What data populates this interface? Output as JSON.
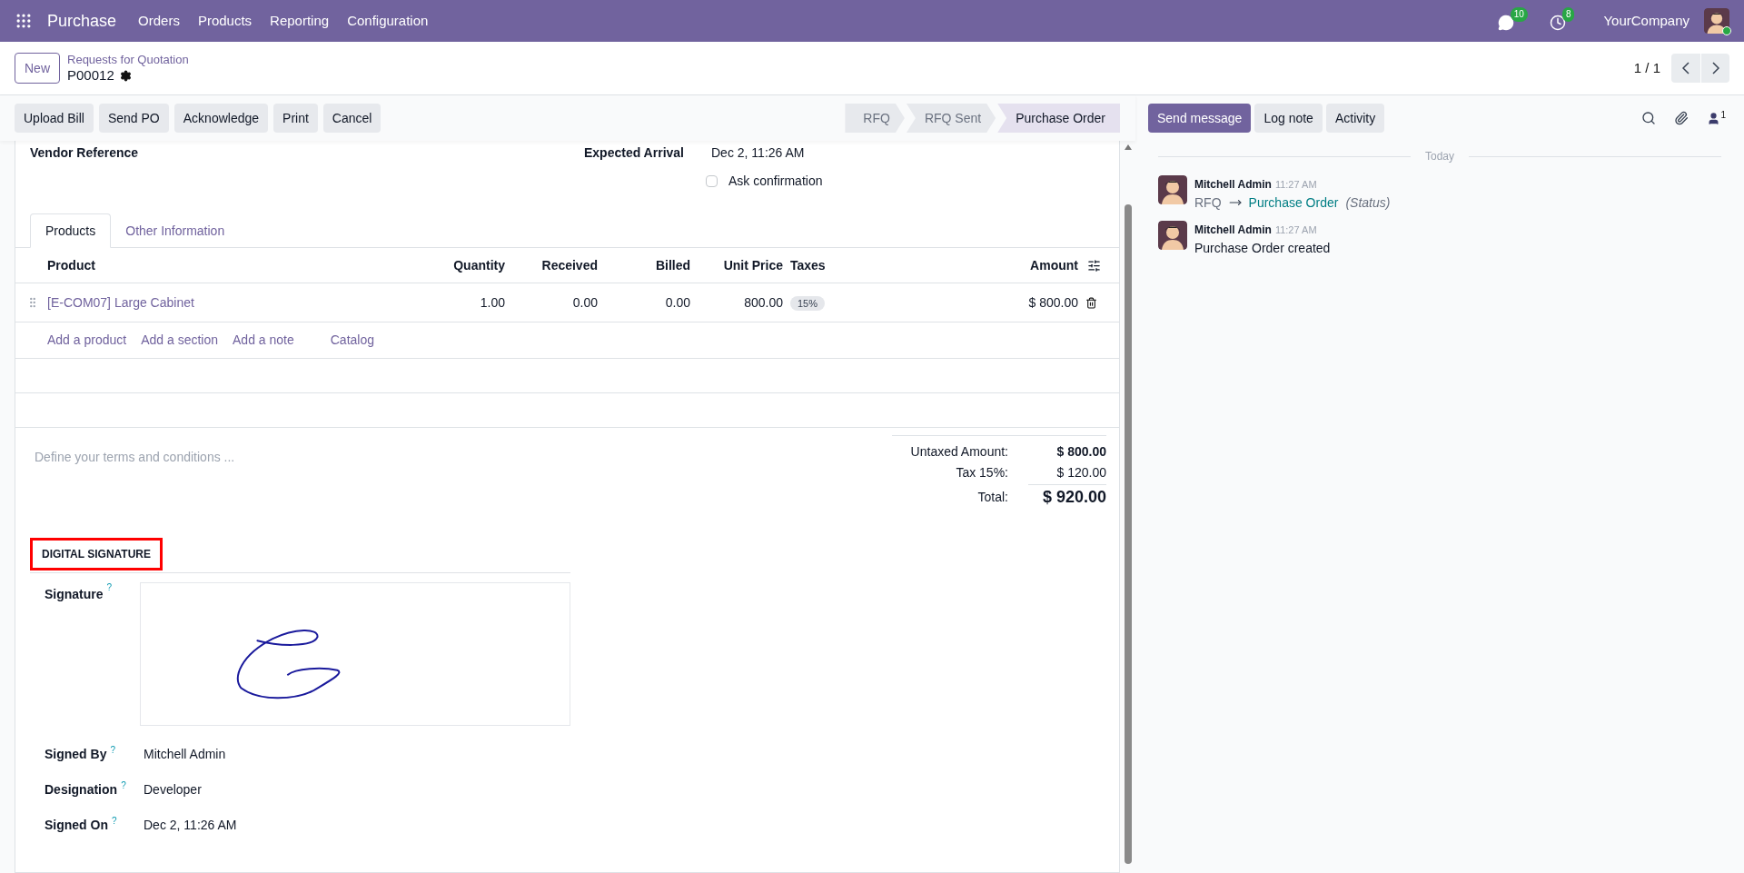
{
  "navbar": {
    "app": "Purchase",
    "menu": [
      "Orders",
      "Products",
      "Reporting",
      "Configuration"
    ],
    "messages_count": "10",
    "activities_count": "8",
    "company": "YourCompany"
  },
  "breadcrumb": {
    "new": "New",
    "parent": "Requests for Quotation",
    "record": "P00012"
  },
  "pager": "1 / 1",
  "actions": [
    "Upload Bill",
    "Send PO",
    "Acknowledge",
    "Print",
    "Cancel"
  ],
  "statusbar": [
    {
      "label": "RFQ",
      "selected": false
    },
    {
      "label": "RFQ Sent",
      "selected": false
    },
    {
      "label": "Purchase Order",
      "selected": true
    }
  ],
  "top_fields": {
    "vendor_reference_label": "Vendor Reference",
    "expected_arrival_label": "Expected Arrival",
    "expected_arrival": "Dec 2, 11:26 AM"
  },
  "ask_confirmation": {
    "label": "Ask confirmation",
    "checked": false
  },
  "tabs": [
    {
      "label": "Products",
      "selected": true
    },
    {
      "label": "Other Information",
      "selected": false
    }
  ],
  "table": {
    "columns": [
      "Product",
      "Quantity",
      "Received",
      "Billed",
      "Unit Price",
      "Taxes",
      "Amount"
    ],
    "rows": [
      {
        "product": "[E-COM07] Large Cabinet",
        "quantity": "1.00",
        "received": "0.00",
        "billed": "0.00",
        "unit_price": "800.00",
        "taxes": "15%",
        "amount": "$ 800.00"
      }
    ],
    "add_links": [
      "Add a product",
      "Add a section",
      "Add a note",
      "Catalog"
    ]
  },
  "terms_placeholder": "Define your terms and conditions ...",
  "totals": [
    {
      "label": "Untaxed Amount:",
      "value": "$ 800.00",
      "kind": "bold"
    },
    {
      "label": "Tax 15%:",
      "value": "$ 120.00",
      "kind": "plain"
    },
    {
      "label": "Total:",
      "value": "$ 920.00",
      "kind": "grand"
    }
  ],
  "signature_section": {
    "title": "DIGITAL SIGNATURE",
    "highlighted": true,
    "fields": [
      {
        "label": "Signature",
        "help": "?",
        "kind": "signature"
      },
      {
        "label": "Signed By",
        "help": "?",
        "kind": "text",
        "value": "Mitchell Admin"
      },
      {
        "label": "Designation",
        "help": "?",
        "kind": "text",
        "value": "Developer"
      },
      {
        "label": "Signed On",
        "help": "?",
        "kind": "text",
        "value": "Dec 2, 11:26 AM"
      }
    ]
  },
  "chatter": {
    "buttons": [
      {
        "label": "Send message",
        "selected": true
      },
      {
        "label": "Log note",
        "selected": false
      },
      {
        "label": "Activity",
        "selected": false
      }
    ],
    "followers_count": "1",
    "date_separator": "Today",
    "messages": [
      {
        "author": "Mitchell Admin",
        "time": "11:27 AM",
        "kind": "tracking",
        "old": "RFQ",
        "new": "Purchase Order",
        "field": "(Status)"
      },
      {
        "author": "Mitchell Admin",
        "time": "11:27 AM",
        "kind": "text",
        "body": "Purchase Order created"
      }
    ]
  }
}
